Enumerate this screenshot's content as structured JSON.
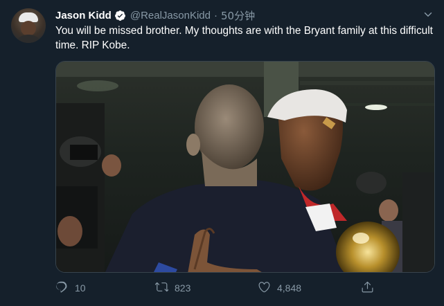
{
  "tweet": {
    "display_name": "Jason Kidd",
    "handle": "@RealJasonKidd",
    "separator": "·",
    "time": "50分钟",
    "text": "You will be missed brother. My thoughts are with the Bryant family at this difficult time. RIP Kobe."
  },
  "actions": {
    "reply_count": "10",
    "retweet_count": "823",
    "like_count": "4,848"
  },
  "colors": {
    "background": "#15202b",
    "secondary_text": "#8899a6",
    "verified": "#ffffff",
    "border": "#38444d"
  },
  "icons": [
    "verified-icon",
    "chevron-down-icon",
    "reply-icon",
    "retweet-icon",
    "like-icon",
    "share-icon"
  ]
}
